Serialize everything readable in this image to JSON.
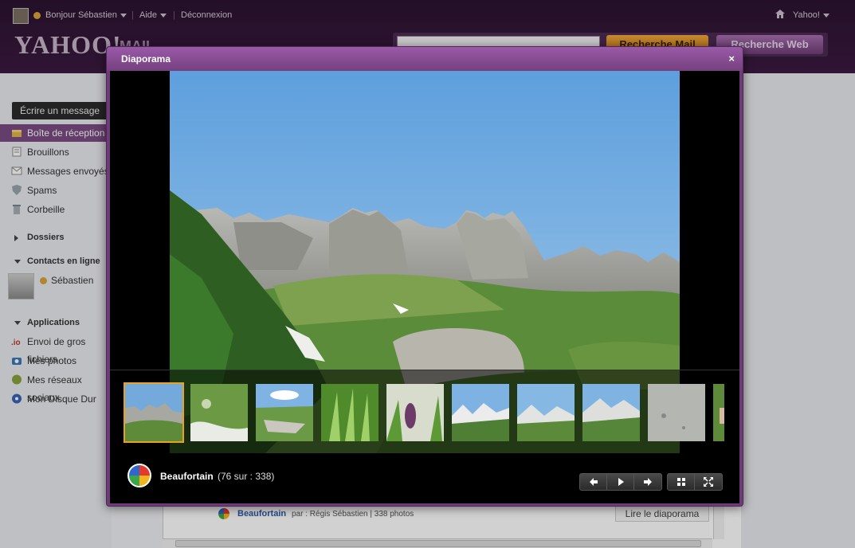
{
  "topbar": {
    "greeting": "Bonjour Sébastien",
    "help": "Aide",
    "logout": "Déconnexion",
    "yahoo_menu": "Yahoo!",
    "logo": "YAHOO!",
    "logo_suffix": "MAIL",
    "search_mail_button": "Recherche Mail",
    "search_web_button": "Recherche Web"
  },
  "sidebar": {
    "compose": "Écrire un message",
    "items": [
      {
        "label": "Boîte de réception",
        "icon": "inbox-icon"
      },
      {
        "label": "Brouillons",
        "icon": "drafts-icon"
      },
      {
        "label": "Messages envoyés",
        "icon": "sent-icon"
      },
      {
        "label": "Spams",
        "icon": "spam-shield-icon"
      },
      {
        "label": "Corbeille",
        "icon": "trash-icon"
      }
    ],
    "folders_header": "Dossiers",
    "contacts_header": "Contacts en ligne",
    "contact_name": "Sébastien",
    "apps_header": "Applications",
    "apps": [
      {
        "label": "Envoi de gros fichiers",
        "icon": "io-icon"
      },
      {
        "label": "Mes photos",
        "icon": "camera-icon"
      },
      {
        "label": "Mes réseaux sociaux",
        "icon": "social-icon"
      },
      {
        "label": "Mon Disque Dur",
        "icon": "disk-icon"
      }
    ]
  },
  "underlying": {
    "album_title": "Beaufortain",
    "album_meta": "par : Régis Sébastien | 338 photos",
    "play_button": "Lire le diaporama"
  },
  "modal": {
    "title": "Diaporama",
    "close": "×",
    "album_name": "Beaufortain",
    "album_count": "(76 sur : 338)",
    "thumbnails_count": 10,
    "selected_thumbnail": 0,
    "controls": {
      "nav": [
        "previous-icon",
        "play-icon",
        "next-icon"
      ],
      "view": [
        "grid-icon",
        "fullscreen-icon"
      ]
    }
  },
  "colors": {
    "accent_purple": "#7b4b83",
    "search_orange": "#e8a21d",
    "sky_blue": "#6fa6da"
  }
}
